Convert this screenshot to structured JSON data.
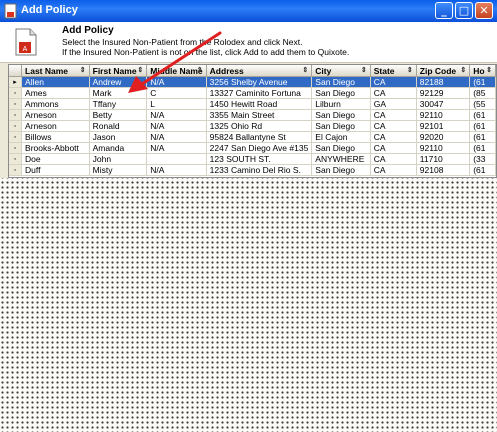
{
  "window": {
    "title": "Add Policy",
    "controls": {
      "minimize": "_",
      "maximize": "□",
      "close": "✕"
    }
  },
  "header": {
    "title": "Add Policy",
    "line1": "Select the Insured Non-Patient from the Rolodex and click Next.",
    "line2": "If the Insured Non-Patient is not on the list, click Add to add them to Quixote."
  },
  "table": {
    "columns": [
      "Last Name",
      "First Name",
      "Middle Name",
      "Address",
      "City",
      "State",
      "Zip Code",
      "Ho"
    ],
    "rows": [
      [
        "Allen",
        "Andrew",
        "N/A",
        "3256 Shelby Avenue",
        "San Diego",
        "CA",
        "82188",
        "(61"
      ],
      [
        "Ames",
        "Mark",
        "C",
        "13327 Caminito Fortuna",
        "San Diego",
        "CA",
        "92129",
        "(85"
      ],
      [
        "Ammons",
        "Tffany",
        "L",
        "1450 Hewitt Road",
        "Lilburn",
        "GA",
        "30047",
        "(55"
      ],
      [
        "Arneson",
        "Betty",
        "N/A",
        "3355 Main Street",
        "San Diego",
        "CA",
        "92110",
        "(61"
      ],
      [
        "Arneson",
        "Ronald",
        "N/A",
        "1325 Ohio Rd",
        "San Diego",
        "CA",
        "92101",
        "(61"
      ],
      [
        "Billows",
        "Jason",
        "N/A",
        "95824 Ballantyne St",
        "El Cajon",
        "CA",
        "92020",
        "(61"
      ],
      [
        "Brooks-Abbott",
        "Amanda",
        "N/A",
        "2247 San Diego Ave #135",
        "San Diego",
        "CA",
        "92110",
        "(61"
      ],
      [
        "Doe",
        "John",
        "",
        "123 SOUTH ST.",
        "ANYWHERE",
        "CA",
        "11710",
        "(33"
      ],
      [
        "Duff",
        "Misty",
        "N/A",
        "1233 Camino Del Rio S.",
        "San Diego",
        "CA",
        "92108",
        "(61"
      ]
    ],
    "selected_row_index": 0
  },
  "colors": {
    "title_bar": "#0b5fe9",
    "selection": "#316ac5",
    "annotation_arrow": "#e02020"
  }
}
